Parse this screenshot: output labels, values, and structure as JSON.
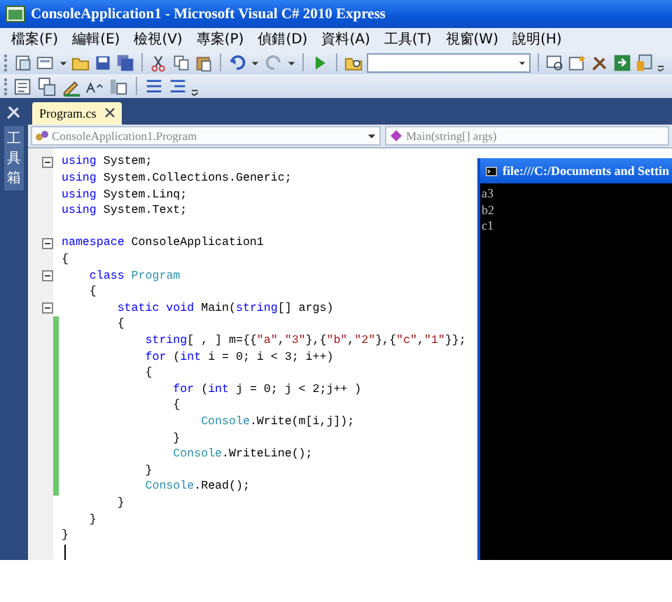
{
  "window": {
    "title": "ConsoleApplication1 - Microsoft Visual C# 2010 Express"
  },
  "menu": [
    "檔案(F)",
    "編輯(E)",
    "檢視(V)",
    "專案(P)",
    "偵錯(D)",
    "資料(A)",
    "工具(T)",
    "視窗(W)",
    "說明(H)"
  ],
  "sidebar": {
    "label": "工具箱"
  },
  "tabs": [
    {
      "label": "Program.cs",
      "selected": true
    }
  ],
  "navigation": {
    "type_dropdown": "ConsoleApplication1.Program",
    "member_dropdown": "Main(string[] args)"
  },
  "lines": [
    {
      "fold": true,
      "changed": false,
      "tokens": [
        {
          "kind": "keyword",
          "text": "using"
        },
        {
          "kind": "plain",
          "text": " System;"
        }
      ]
    },
    {
      "fold": false,
      "changed": false,
      "tokens": [
        {
          "kind": "keyword",
          "text": "using"
        },
        {
          "kind": "plain",
          "text": " System.Collections.Generic;"
        }
      ]
    },
    {
      "fold": false,
      "changed": false,
      "tokens": [
        {
          "kind": "keyword",
          "text": "using"
        },
        {
          "kind": "plain",
          "text": " System.Linq;"
        }
      ]
    },
    {
      "fold": false,
      "changed": false,
      "tokens": [
        {
          "kind": "keyword",
          "text": "using"
        },
        {
          "kind": "plain",
          "text": " System.Text;"
        }
      ]
    },
    {
      "fold": false,
      "changed": false
    },
    {
      "fold": true,
      "changed": false,
      "tokens": [
        {
          "kind": "keyword",
          "text": "namespace"
        },
        {
          "kind": "plain",
          "text": " ConsoleApplication1"
        }
      ]
    },
    {
      "fold": false,
      "changed": false,
      "tokens": [
        {
          "kind": "plain",
          "text": "{"
        }
      ]
    },
    {
      "fold": true,
      "changed": false,
      "tokens": [
        {
          "kind": "keyword",
          "text": "    class "
        },
        {
          "kind": "type",
          "text": "Program"
        }
      ]
    },
    {
      "fold": false,
      "changed": false,
      "tokens": [
        {
          "kind": "plain",
          "text": "    {"
        }
      ]
    },
    {
      "fold": true,
      "changed": false,
      "tokens": [
        {
          "kind": "keyword",
          "text": "        static void"
        },
        {
          "kind": "plain",
          "text": " Main("
        },
        {
          "kind": "keyword",
          "text": "string"
        },
        {
          "kind": "plain",
          "text": "[] args)"
        }
      ]
    },
    {
      "fold": false,
      "changed": true,
      "tokens": [
        {
          "kind": "plain",
          "text": "        {"
        }
      ]
    },
    {
      "fold": false,
      "changed": true,
      "tokens": [
        {
          "kind": "keyword",
          "text": "            string"
        },
        {
          "kind": "plain",
          "text": "[ , ] m={{"
        },
        {
          "kind": "string",
          "text": "\"a\""
        },
        {
          "kind": "plain",
          "text": ","
        },
        {
          "kind": "string",
          "text": "\"3\""
        },
        {
          "kind": "plain",
          "text": "},{"
        },
        {
          "kind": "string",
          "text": "\"b\""
        },
        {
          "kind": "plain",
          "text": ","
        },
        {
          "kind": "string",
          "text": "\"2\""
        },
        {
          "kind": "plain",
          "text": "},{"
        },
        {
          "kind": "string",
          "text": "\"c\""
        },
        {
          "kind": "plain",
          "text": ","
        },
        {
          "kind": "string",
          "text": "\"1\""
        },
        {
          "kind": "plain",
          "text": "}};"
        }
      ]
    },
    {
      "fold": false,
      "changed": true,
      "tokens": [
        {
          "kind": "keyword",
          "text": "            for"
        },
        {
          "kind": "plain",
          "text": " ("
        },
        {
          "kind": "keyword",
          "text": "int"
        },
        {
          "kind": "plain",
          "text": " i = 0; i < 3; i++)"
        }
      ]
    },
    {
      "fold": false,
      "changed": true,
      "tokens": [
        {
          "kind": "plain",
          "text": "            {"
        }
      ]
    },
    {
      "fold": false,
      "changed": true,
      "tokens": [
        {
          "kind": "keyword",
          "text": "                for"
        },
        {
          "kind": "plain",
          "text": " ("
        },
        {
          "kind": "keyword",
          "text": "int"
        },
        {
          "kind": "plain",
          "text": " j = 0; j < 2;j++ )"
        }
      ]
    },
    {
      "fold": false,
      "changed": true,
      "tokens": [
        {
          "kind": "plain",
          "text": "                {"
        }
      ]
    },
    {
      "fold": false,
      "changed": true,
      "tokens": [
        {
          "kind": "type",
          "text": "                    Console"
        },
        {
          "kind": "plain",
          "text": ".Write(m[i,j]);"
        }
      ]
    },
    {
      "fold": false,
      "changed": true,
      "tokens": [
        {
          "kind": "plain",
          "text": "                }"
        }
      ]
    },
    {
      "fold": false,
      "changed": true,
      "tokens": [
        {
          "kind": "type",
          "text": "                Console"
        },
        {
          "kind": "plain",
          "text": ".WriteLine();"
        }
      ]
    },
    {
      "fold": false,
      "changed": true,
      "tokens": [
        {
          "kind": "plain",
          "text": "            }"
        }
      ]
    },
    {
      "fold": false,
      "changed": true,
      "tokens": [
        {
          "kind": "type",
          "text": "            Console"
        },
        {
          "kind": "plain",
          "text": ".Read();"
        }
      ]
    },
    {
      "fold": false,
      "changed": false,
      "tokens": [
        {
          "kind": "plain",
          "text": "        }"
        }
      ]
    },
    {
      "fold": false,
      "changed": false,
      "tokens": [
        {
          "kind": "plain",
          "text": "    }"
        }
      ]
    },
    {
      "fold": false,
      "changed": false,
      "tokens": [
        {
          "kind": "plain",
          "text": "}"
        }
      ]
    }
  ],
  "console": {
    "title": "file:///C:/Documents and Settin",
    "output": [
      "a3",
      "b2",
      "c1"
    ]
  }
}
